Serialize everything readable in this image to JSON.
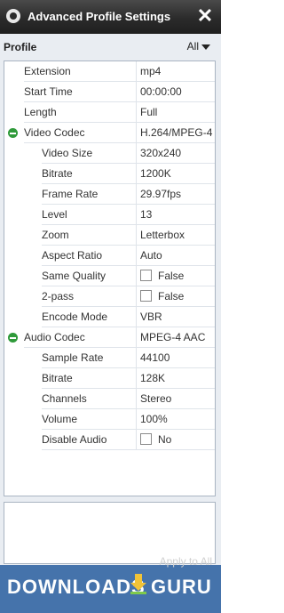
{
  "window": {
    "title": "Advanced Profile Settings"
  },
  "profile": {
    "label": "Profile",
    "selected": "All"
  },
  "rows": [
    {
      "name": "Extension",
      "value": "mp4",
      "level": 1
    },
    {
      "name": "Start Time",
      "value": "00:00:00",
      "level": 1
    },
    {
      "name": "Length",
      "value": "Full",
      "level": 1
    },
    {
      "name": "Video Codec",
      "value": "H.264/MPEG-4 ..",
      "level": 0,
      "expander": true
    },
    {
      "name": "Video Size",
      "value": "320x240",
      "level": 2
    },
    {
      "name": "Bitrate",
      "value": "1200K",
      "level": 2
    },
    {
      "name": "Frame Rate",
      "value": "29.97fps",
      "level": 2
    },
    {
      "name": "Level",
      "value": "13",
      "level": 2
    },
    {
      "name": "Zoom",
      "value": "Letterbox",
      "level": 2
    },
    {
      "name": "Aspect Ratio",
      "value": "Auto",
      "level": 2
    },
    {
      "name": "Same Quality",
      "value": "False",
      "level": 2,
      "checkbox": true
    },
    {
      "name": "2-pass",
      "value": "False",
      "level": 2,
      "checkbox": true
    },
    {
      "name": "Encode Mode",
      "value": "VBR",
      "level": 2
    },
    {
      "name": "Audio Codec",
      "value": "MPEG-4 AAC",
      "level": 0,
      "expander": true
    },
    {
      "name": "Sample Rate",
      "value": "44100",
      "level": 2
    },
    {
      "name": "Bitrate",
      "value": "128K",
      "level": 2
    },
    {
      "name": "Channels",
      "value": "Stereo",
      "level": 2
    },
    {
      "name": "Volume",
      "value": "100%",
      "level": 2
    },
    {
      "name": "Disable Audio",
      "value": "No",
      "level": 2,
      "checkbox": true
    }
  ],
  "watermark": {
    "text_left": "DOWNLOADS",
    "text_right": "GURU"
  },
  "footer": {
    "apply_label": "Apply to All"
  },
  "colors": {
    "titlebar": "#2b2b2b",
    "expander": "#2f9a3a",
    "watermark": "#3d6da8"
  }
}
